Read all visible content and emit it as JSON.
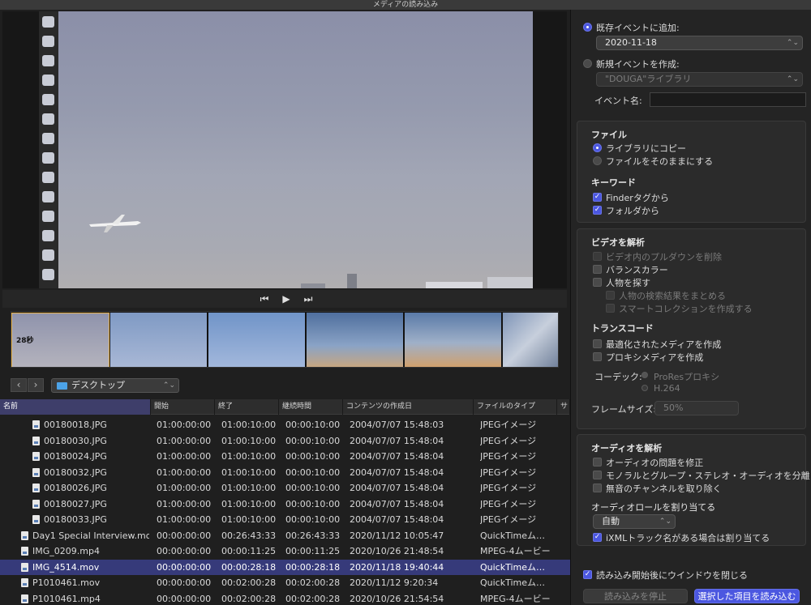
{
  "window": {
    "title": "メディアの読み込み"
  },
  "viewer": {
    "thumb_label": "28秒"
  },
  "navigation": {
    "back": "‹",
    "forward": "›",
    "location": "デスクトップ"
  },
  "table": {
    "headers": [
      "名前",
      "開始",
      "終了",
      "継続時間",
      "コンテンツの作成日",
      "ファイルのタイプ",
      "サ"
    ],
    "rows": [
      {
        "name": "00180018.JPG",
        "start": "01:00:00:00",
        "end": "01:00:10:00",
        "duration": "00:00:10:00",
        "created": "2004/07/07 15:48:03",
        "type": "JPEGイメージ"
      },
      {
        "name": "00180030.JPG",
        "start": "01:00:00:00",
        "end": "01:00:10:00",
        "duration": "00:00:10:00",
        "created": "2004/07/07 15:48:04",
        "type": "JPEGイメージ"
      },
      {
        "name": "00180024.JPG",
        "start": "01:00:00:00",
        "end": "01:00:10:00",
        "duration": "00:00:10:00",
        "created": "2004/07/07 15:48:04",
        "type": "JPEGイメージ"
      },
      {
        "name": "00180032.JPG",
        "start": "01:00:00:00",
        "end": "01:00:10:00",
        "duration": "00:00:10:00",
        "created": "2004/07/07 15:48:04",
        "type": "JPEGイメージ"
      },
      {
        "name": "00180026.JPG",
        "start": "01:00:00:00",
        "end": "01:00:10:00",
        "duration": "00:00:10:00",
        "created": "2004/07/07 15:48:04",
        "type": "JPEGイメージ"
      },
      {
        "name": "00180027.JPG",
        "start": "01:00:00:00",
        "end": "01:00:10:00",
        "duration": "00:00:10:00",
        "created": "2004/07/07 15:48:04",
        "type": "JPEGイメージ"
      },
      {
        "name": "00180033.JPG",
        "start": "01:00:00:00",
        "end": "01:00:10:00",
        "duration": "00:00:10:00",
        "created": "2004/07/07 15:48:04",
        "type": "JPEGイメージ"
      },
      {
        "name": "Day1 Special Interview.mov",
        "start": "00:00:00:00",
        "end": "00:26:43:33",
        "duration": "00:26:43:33",
        "created": "2020/11/12 10:05:47",
        "type": "QuickTimeム…"
      },
      {
        "name": "IMG_0209.mp4",
        "start": "00:00:00:00",
        "end": "00:00:11:25",
        "duration": "00:00:11:25",
        "created": "2020/10/26 21:48:54",
        "type": "MPEG-4ムービー"
      },
      {
        "name": "IMG_4514.mov",
        "start": "00:00:00:00",
        "end": "00:00:28:18",
        "duration": "00:00:28:18",
        "created": "2020/11/18 19:40:44",
        "type": "QuickTimeム…"
      },
      {
        "name": "P1010461.mov",
        "start": "00:00:00:00",
        "end": "00:02:00:28",
        "duration": "00:02:00:28",
        "created": "2020/11/12 9:20:34",
        "type": "QuickTimeム…"
      },
      {
        "name": "P1010461.mp4",
        "start": "00:00:00:00",
        "end": "00:02:00:28",
        "duration": "00:02:00:28",
        "created": "2020/10/26 21:54:54",
        "type": "MPEG-4ムービー"
      }
    ]
  },
  "event": {
    "add_existing_label": "既存イベントに追加:",
    "existing_value": "2020-11-18",
    "create_new_label": "新規イベントを作成:",
    "library_value": "\"DOUGA\"ライブラリ",
    "event_name_label": "イベント名:",
    "event_name_value": ""
  },
  "files": {
    "title": "ファイル",
    "copy_to_library": "ライブラリにコピー",
    "leave_in_place": "ファイルをそのままにする",
    "keywords_title": "キーワード",
    "from_finder_tags": "Finderタグから",
    "from_folders": "フォルダから"
  },
  "video": {
    "title": "ビデオを解析",
    "remove_pulldown": "ビデオ内のプルダウンを削除",
    "balance_color": "バランスカラー",
    "find_people": "人物を探す",
    "consolidate": "人物の検索結果をまとめる",
    "smart_collections": "スマートコレクションを作成する",
    "transcode_title": "トランスコード",
    "optimized_media": "最適化されたメディアを作成",
    "proxy_media": "プロキシメディアを作成",
    "codec_label": "コーデック:",
    "codec_prores": "ProResプロキシ",
    "codec_h264": "H.264",
    "frame_size_label": "フレームサイズ:",
    "frame_size_value": "50%"
  },
  "audio": {
    "title": "オーディオを解析",
    "fix_problems": "オーディオの問題を修正",
    "separate_mono": "モノラルとグループ・ステレオ・オーディオを分離",
    "remove_silent": "無音のチャンネルを取り除く",
    "assign_roles_title": "オーディオロールを割り当てる",
    "role_value": "自動",
    "ixml": "iXMLトラック名がある場合は割り当てる"
  },
  "footer": {
    "close_window": "読み込み開始後にウインドウを閉じる",
    "stop_import": "読み込みを停止",
    "import_selected": "選択した項目を読み込む"
  }
}
